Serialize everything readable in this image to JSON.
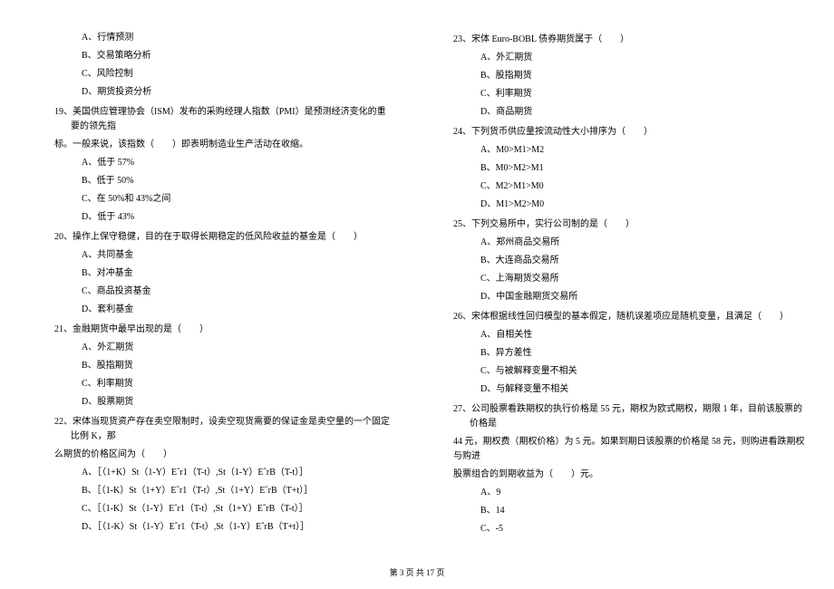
{
  "left_column": {
    "opt_18A": "A、行情预测",
    "opt_18B": "B、交易策略分析",
    "opt_18C": "C、风险控制",
    "opt_18D": "D、期货投资分析",
    "q19": "19、美国供应管理协会（ISM）发布的采购经理人指数（PMI）是预测经济变化的重要的领先指",
    "q19_cont": "标。一般来说，该指数（　　）即表明制造业生产活动在收缩。",
    "opt_19A": "A、低于 57%",
    "opt_19B": "B、低于 50%",
    "opt_19C": "C、在 50%和 43%之间",
    "opt_19D": "D、低于 43%",
    "q20": "20、操作上保守稳健，目的在于取得长期稳定的低风险收益的基金是（　　）",
    "opt_20A": "A、共同基金",
    "opt_20B": "B、对冲基金",
    "opt_20C": "C、商品投资基金",
    "opt_20D": "D、套利基金",
    "q21": "21、金融期货中最早出现的是（　　）",
    "opt_21A": "A、外汇期货",
    "opt_21B": "B、股指期货",
    "opt_21C": "C、利率期货",
    "opt_21D": "D、股票期货",
    "q22": "22、宋体当现货资产存在卖空限制时，设卖空现货需要的保证金是卖空量的一个固定比例 K，那",
    "q22_cont": "么期货的价格区间为（　　）",
    "opt_22A": "A、［（1+K）St（1-Y）Eˆr1（T-t）,St（1-Y）EˆrB（T-t）］",
    "opt_22B": "B、［（1-K）St（1+Y）Eˆr1（T-t）,St（1+Y）EˆrB（T+t）］",
    "opt_22C": "C、［（1-K）St（1-Y）Eˆr1（T-t）,St（1+Y）EˆrB（T-t）］",
    "opt_22D": "D、［（1-K）St（1-Y）Eˆr1（T-t）,St（1-Y）EˆrB（T+t）］"
  },
  "right_column": {
    "q23": "23、宋体 Euro-BOBL 债券期货属于（　　）",
    "opt_23A": "A、外汇期货",
    "opt_23B": "B、股指期货",
    "opt_23C": "C、利率期货",
    "opt_23D": "D、商品期货",
    "q24": "24、下列货币供应量按流动性大小排序为（　　）",
    "opt_24A": "A、M0>M1>M2",
    "opt_24B": "B、M0>M2>M1",
    "opt_24C": "C、M2>M1>M0",
    "opt_24D": "D、M1>M2>M0",
    "q25": "25、下列交易所中，实行公司制的是（　　）",
    "opt_25A": "A、郑州商品交易所",
    "opt_25B": "B、大连商品交易所",
    "opt_25C": "C、上海期货交易所",
    "opt_25D": "D、中国金融期货交易所",
    "q26": "26、宋体根据线性回归模型的基本假定，随机误差项应是随机变量，且满足（　　）",
    "opt_26A": "A、自相关性",
    "opt_26B": "B、异方差性",
    "opt_26C": "C、与被解释变量不相关",
    "opt_26D": "D、与解释变量不相关",
    "q27": "27、公司股票看跌期权的执行价格是 55 元，期权为欧式期权，期限 1 年，目前该股票的价格是",
    "q27_cont1": "44 元，期权费（期权价格）为 5 元。如果到期日该股票的价格是 58 元，则购进看跌期权与购进",
    "q27_cont2": "股票组合的到期收益为（　　）元。",
    "opt_27A": "A、9",
    "opt_27B": "B、14",
    "opt_27C": "C、-5"
  },
  "footer": "第 3 页 共 17 页"
}
